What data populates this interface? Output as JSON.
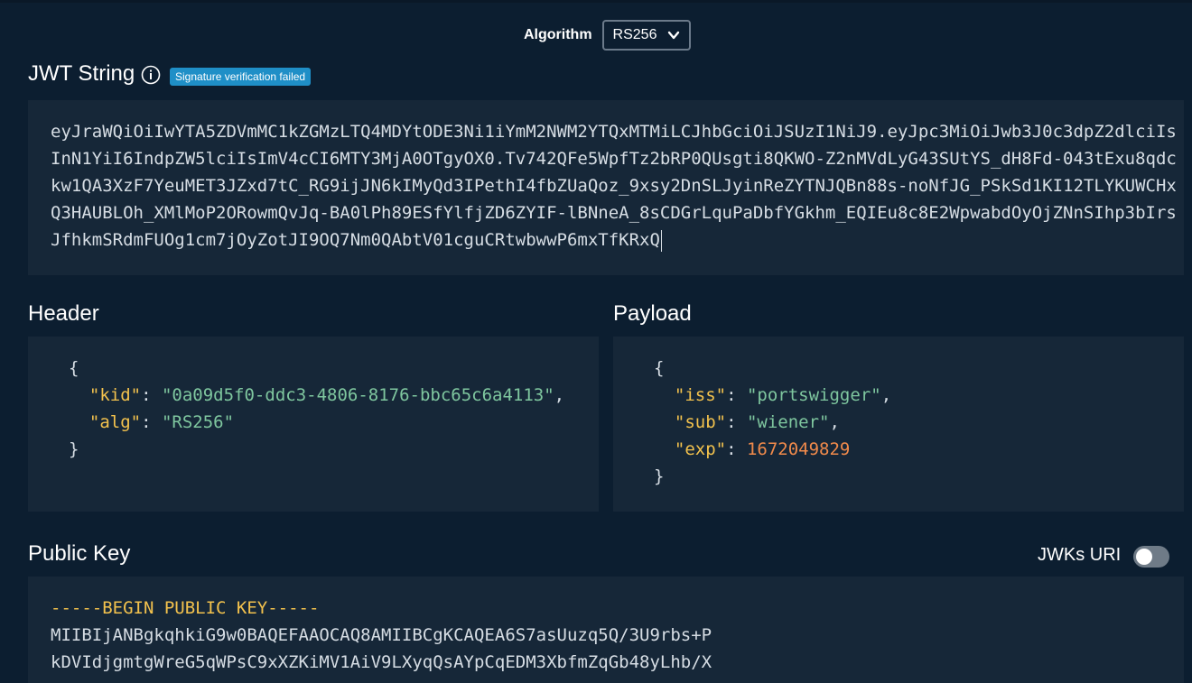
{
  "algorithm": {
    "label": "Algorithm",
    "selected": "RS256"
  },
  "jwt": {
    "title": "JWT String",
    "status_badge": "Signature verification failed",
    "token": "eyJraWQiOiIwYTA5ZDVmMC1kZGMzLTQ4MDYtODE3Ni1iYmM2NWM2YTQxMTMiLCJhbGciOiJSUzI1NiJ9.eyJpc3MiOiJwb3J0c3dpZ2dlciIsInN1YiI6IndpZW5lciIsImV4cCI6MTY3MjA0OTgyOX0.Tv742QFe5WpfTz2bRP0QUsgti8QKWO-Z2nMVdLyG43SUtYS_dH8Fd-043tExu8qdckw1QA3XzF7YeuMET3JZxd7tC_RG9ijJN6kIMyQd3IPethI4fbZUaQoz_9xsy2DnSLJyinReZYTNJQBn88s-noNfJG_PSkSd1KI12TLYKUWCHxQ3HAUBLOh_XMlMoP2ORowmQvJq-BA0lPh89ESfYlfjZD6ZYIF-lBNneA_8sCDGrLquPaDbfYGkhm_EQIEu8c8E2WpwabdOyOjZNnSIhp3bIrsJfhkmSRdmFUOg1cm7jOyZotJI9OQ7Nm0QAbtV01cguCRtwbwwP6mxTfKRxQ"
  },
  "header": {
    "title": "Header",
    "open_brace": "{",
    "close_brace": "}",
    "kid_key": "\"kid\"",
    "kid_value": "\"0a09d5f0-ddc3-4806-8176-bbc65c6a4113\"",
    "alg_key": "\"alg\"",
    "alg_value": "\"RS256\""
  },
  "payload": {
    "title": "Payload",
    "open_brace": "{",
    "close_brace": "}",
    "iss_key": "\"iss\"",
    "iss_value": "\"portswigger\"",
    "sub_key": "\"sub\"",
    "sub_value": "\"wiener\"",
    "exp_key": "\"exp\"",
    "exp_value": "1672049829"
  },
  "public_key": {
    "title": "Public Key",
    "jwks_label": "JWKs URI",
    "jwks_enabled": false,
    "begin_line": "-----BEGIN PUBLIC KEY-----",
    "lines": [
      "MIIBIjANBgkqhkiG9w0BAQEFAAOCAQ8AMIIBCgKCAQEA6S7asUuzq5Q/3U9rbs+P",
      "kDVIdjgmtgWreG5qWPsC9xXZKiMV1AiV9LXyqQsAYpCqEDM3XbfmZqGb48yLhb/X"
    ]
  },
  "colors": {
    "background": "#0c1e30",
    "panel": "#162738",
    "badge": "#1f8fc7",
    "json_key": "#f3c24d",
    "json_string": "#7fc79f",
    "json_number": "#f08a4b"
  }
}
